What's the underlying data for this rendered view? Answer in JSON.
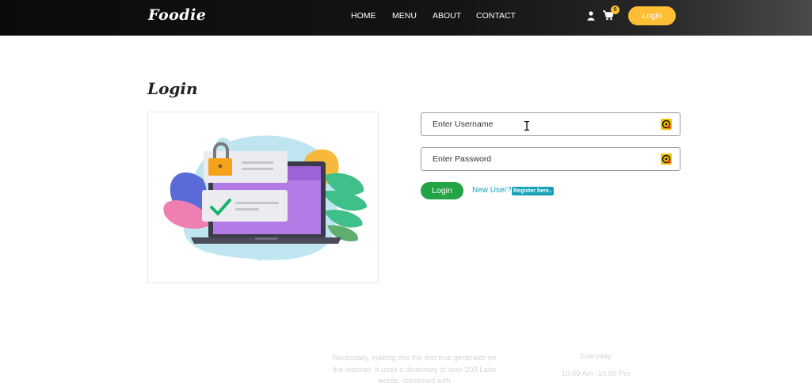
{
  "header": {
    "brand": "Foodie",
    "nav": [
      {
        "label": "HOME"
      },
      {
        "label": "MENU"
      },
      {
        "label": "ABOUT"
      },
      {
        "label": "CONTACT"
      }
    ],
    "cart_count": "0",
    "login_label": "Login",
    "icons": [
      "user-icon",
      "cart-icon"
    ],
    "accent_color": "#ffbe33"
  },
  "main": {
    "title": "Login",
    "username": {
      "placeholder": "Enter Username",
      "value": ""
    },
    "password": {
      "placeholder": "Enter Password",
      "value": ""
    },
    "login_button": "Login",
    "new_user_text": "New User?",
    "register_label": "Register here..",
    "colors": {
      "login_button": "#22a447",
      "register": "#17a2b8"
    }
  },
  "footer": {
    "text": "Necessary, making this the first true generator on the Internet. It uses a dictionary of over 200 Latin words, combined with",
    "hours_label": "Everyday",
    "hours": "10.00 Am -10.00 Pm"
  }
}
